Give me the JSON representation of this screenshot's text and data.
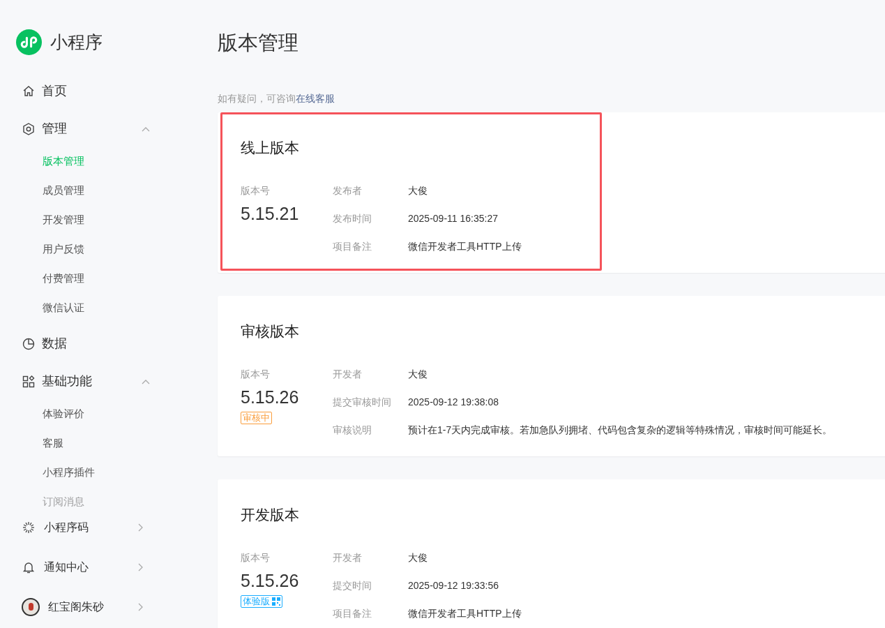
{
  "sidebar": {
    "brand": "小程序",
    "items": [
      {
        "kind": "link",
        "label": "首页"
      },
      {
        "kind": "group",
        "label": "管理",
        "expanded": true,
        "children": [
          {
            "label": "版本管理",
            "selected": true,
            "faded": false
          },
          {
            "label": "成员管理",
            "selected": false,
            "faded": false
          },
          {
            "label": "开发管理",
            "selected": false,
            "faded": false
          },
          {
            "label": "用户反馈",
            "selected": false,
            "faded": false
          },
          {
            "label": "付费管理",
            "selected": false,
            "faded": false
          },
          {
            "label": "微信认证",
            "selected": false,
            "faded": false
          }
        ]
      },
      {
        "kind": "link",
        "label": "数据"
      },
      {
        "kind": "group",
        "label": "基础功能",
        "expanded": true,
        "children": [
          {
            "label": "体验评价",
            "selected": false,
            "faded": false
          },
          {
            "label": "客服",
            "selected": false,
            "faded": false
          },
          {
            "label": "小程序插件",
            "selected": false,
            "faded": false
          },
          {
            "label": "订阅消息",
            "selected": false,
            "faded": true
          }
        ]
      }
    ],
    "footer": [
      {
        "kind": "menu",
        "label": "小程序码"
      },
      {
        "kind": "menu",
        "label": "通知中心"
      },
      {
        "kind": "account",
        "label": "红宝阁朱砂"
      }
    ]
  },
  "page": {
    "title": "版本管理",
    "help": {
      "text": "如有疑问，可咨询",
      "link": "在线客服"
    }
  },
  "versions": [
    {
      "title": "线上版本",
      "highlighted": true,
      "number_label": "版本号",
      "number": "5.15.21",
      "rows": [
        {
          "label": "发布者",
          "value": "大俊"
        },
        {
          "label": "发布时间",
          "value": "2025-09-11 16:35:27"
        },
        {
          "label": "项目备注",
          "value": "微信开发者工具HTTP上传"
        }
      ]
    },
    {
      "title": "审核版本",
      "highlighted": false,
      "number_label": "版本号",
      "number": "5.15.26",
      "tag": {
        "kind": "review",
        "text": "审核中"
      },
      "rows": [
        {
          "label": "开发者",
          "value": "大俊"
        },
        {
          "label": "提交审核时间",
          "value": "2025-09-12 19:38:08"
        },
        {
          "label": "审核说明",
          "value": "预计在1-7天内完成审核。若加急队列拥堵、代码包含复杂的逻辑等特殊情况，审核时间可能延长。"
        }
      ]
    },
    {
      "title": "开发版本",
      "highlighted": false,
      "number_label": "版本号",
      "number": "5.15.26",
      "tag": {
        "kind": "trial",
        "text": "体验版"
      },
      "rows": [
        {
          "label": "开发者",
          "value": "大俊"
        },
        {
          "label": "提交时间",
          "value": "2025-09-12 19:33:56"
        },
        {
          "label": "项目备注",
          "value": "微信开发者工具HTTP上传"
        }
      ]
    }
  ]
}
